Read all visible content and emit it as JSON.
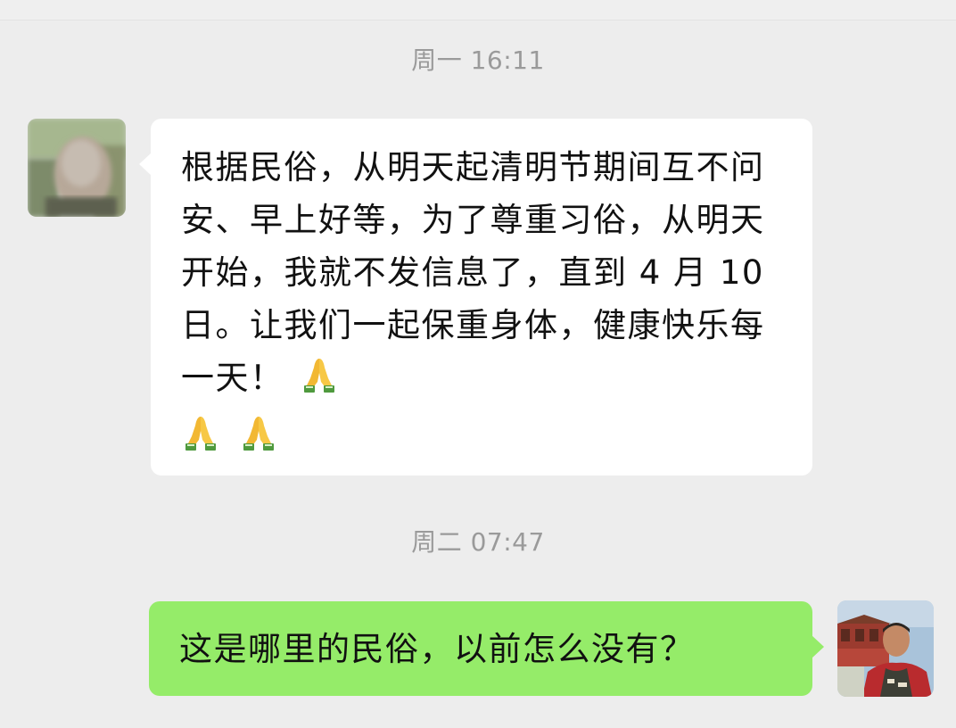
{
  "chat": {
    "timestamps": [
      "周一 16:11",
      "周二 07:47"
    ],
    "messages": [
      {
        "sender": "other",
        "text": "根据民俗，从明天起清明节期间互不问安、早上好等，为了尊重习俗，从明天开始，我就不发信息了，直到 4 月 10 日。让我们一起保重身体，健康快乐每一天！",
        "emoji": [
          "folded-hands-icon",
          "folded-hands-icon",
          "folded-hands-icon"
        ]
      },
      {
        "sender": "self",
        "text": "这是哪里的民俗，以前怎么没有？"
      }
    ]
  },
  "colors": {
    "background": "#ededed",
    "incoming_bubble": "#ffffff",
    "outgoing_bubble": "#95ec69",
    "timestamp": "#9a9a9a"
  }
}
